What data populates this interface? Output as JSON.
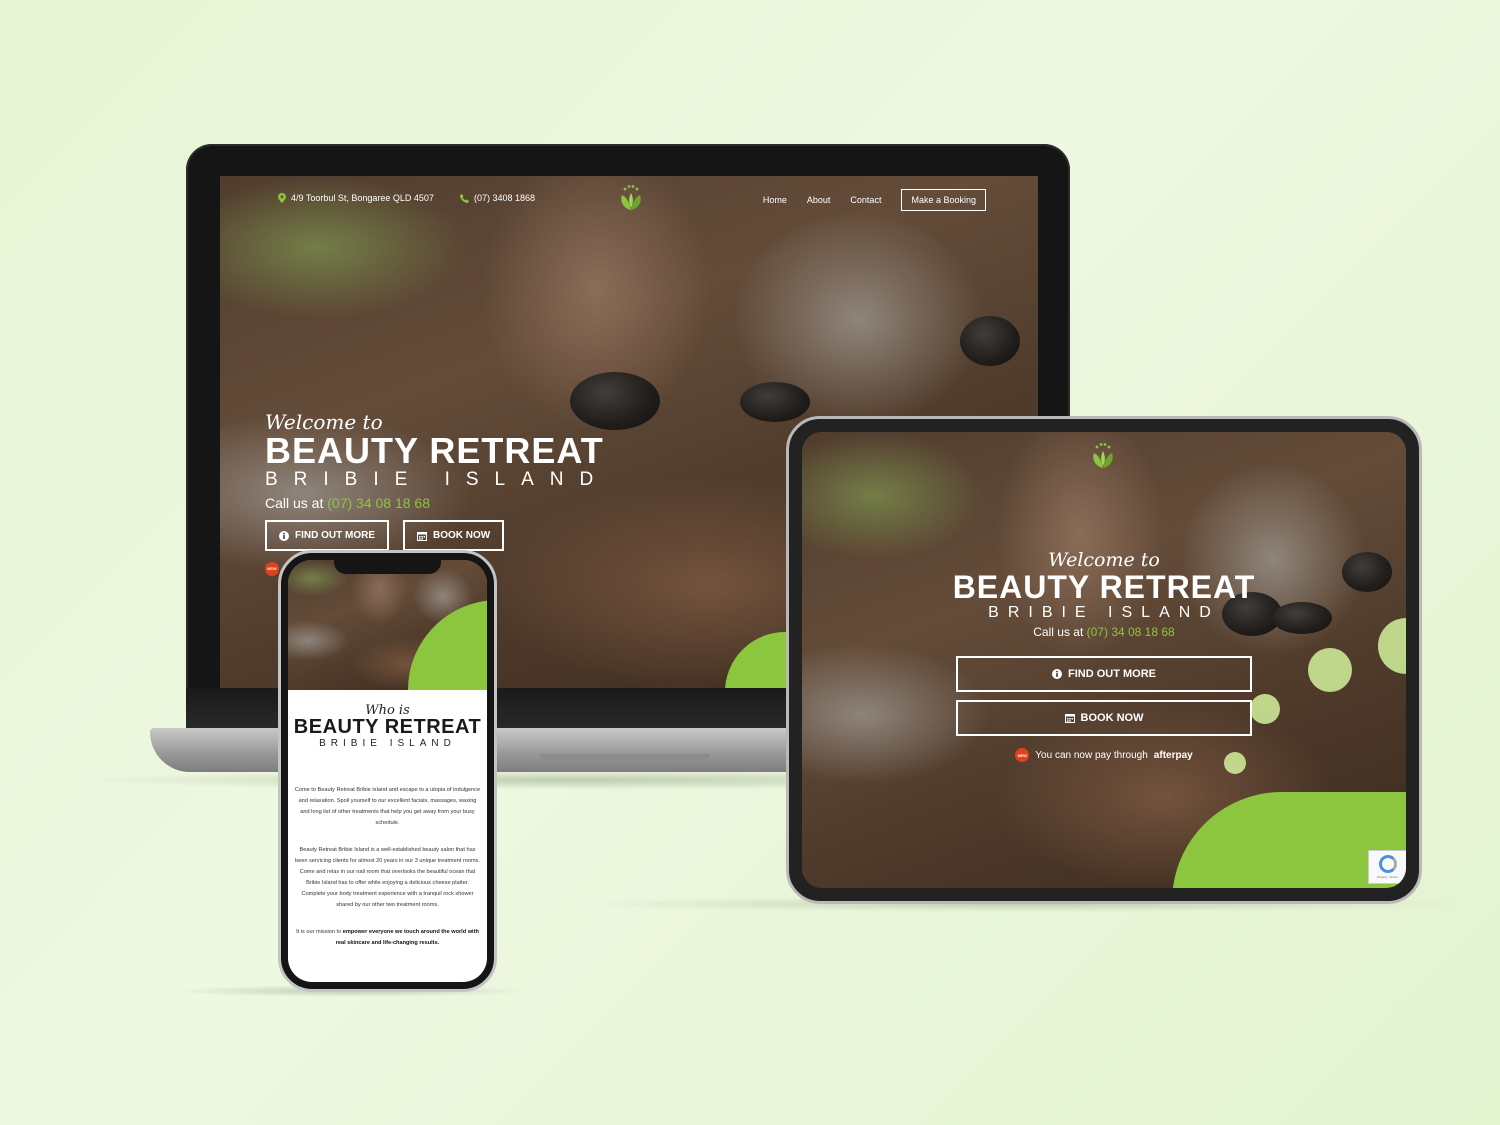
{
  "colors": {
    "accent_green": "#8cc63f",
    "badge_red": "#e2401c"
  },
  "icons": {
    "location": "map-pin-icon",
    "phone": "phone-icon",
    "logo": "leaf-logo-icon",
    "info": "info-icon",
    "calendar": "calendar-icon",
    "new": "new-badge-icon"
  },
  "laptop": {
    "topbar": {
      "address": "4/9 Toorbul St, Bongaree QLD 4507",
      "phone": "(07) 3408 1868"
    },
    "nav": {
      "home": "Home",
      "about": "About",
      "contact": "Contact",
      "booking": "Make a Booking"
    },
    "hero": {
      "welcome": "Welcome to",
      "title": "BEAUTY RETREAT",
      "subtitle": "BRIBIE ISLAND",
      "call_prefix": "Call us at",
      "call_number": "(07) 34 08 18 68",
      "find_out_more": "FIND OUT MORE",
      "book_now": "BOOK NOW",
      "new_badge": "NEW"
    }
  },
  "tablet": {
    "hero": {
      "welcome": "Welcome to",
      "title": "BEAUTY RETREAT",
      "subtitle": "BRIBIE ISLAND",
      "call_prefix": "Call us at",
      "call_number": "(07) 34 08 18 68",
      "find_out_more": "FIND OUT MORE",
      "book_now": "BOOK NOW",
      "new_badge": "NEW",
      "afterpay_text": "You can now pay through",
      "afterpay_brand": "afterpay"
    },
    "recaptcha_text": "Privacy - Terms"
  },
  "phone": {
    "about": {
      "who": "Who is",
      "title": "BEAUTY RETREAT",
      "subtitle": "BRIBIE ISLAND",
      "para1": "Come to Beauty Retreat Bribie Island and escape to a utopia of indulgence and relaxation. Spoil yourself to our excellent facials, massages, waxing and long list of other treatments that help you get away from your busy schedule.",
      "para2": "Beauty Retreat Bribie Island is a well-established beauty salon that has been servicing clients for almost 20 years in our 3 unique treatment rooms. Come and relax in our nail room that overlooks the beautiful ocean that Bribie Island has to offer while enjoying a delicious cheese platter. Complete your body treatment experience with a tranquil rock shower shared by our other two treatment rooms.",
      "para3_prefix": "It is our mission to",
      "para3_bold": "empower everyone we touch around the world with real skincare and life-changing results."
    }
  }
}
